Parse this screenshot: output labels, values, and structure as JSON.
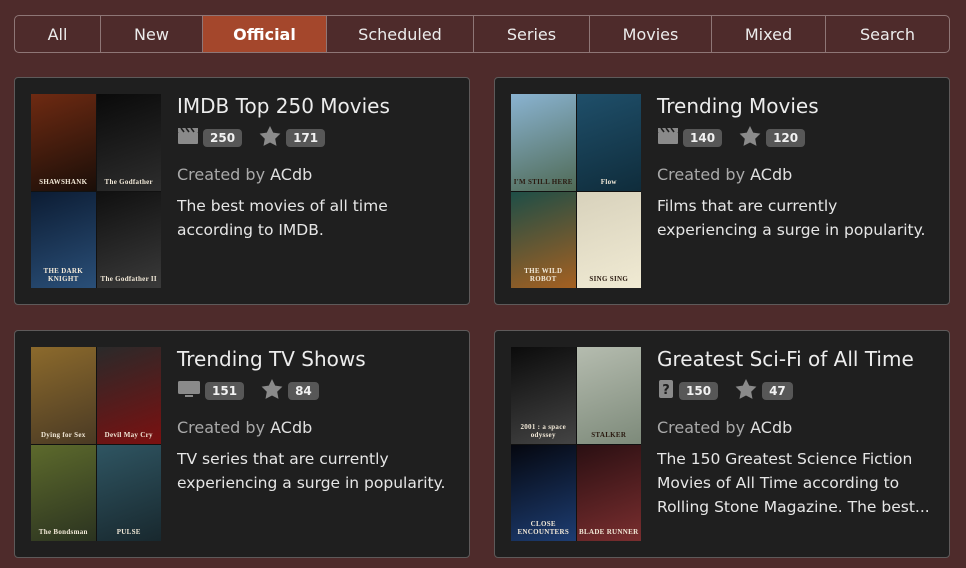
{
  "tabs": [
    {
      "label": "All",
      "active": false
    },
    {
      "label": "New",
      "active": false
    },
    {
      "label": "Official",
      "active": true
    },
    {
      "label": "Scheduled",
      "active": false
    },
    {
      "label": "Series",
      "active": false
    },
    {
      "label": "Movies",
      "active": false
    },
    {
      "label": "Mixed",
      "active": false
    },
    {
      "label": "Search",
      "active": false
    }
  ],
  "lists": [
    {
      "title": "IMDB Top 250 Movies",
      "type_icon": "clapperboard-icon",
      "item_count": "250",
      "rating_count": "171",
      "created_by_label": "Created by",
      "creator": "ACdb",
      "description": "The best movies of all time according to IMDB.",
      "posters": [
        {
          "name": "poster-shawshank",
          "caption": "SHAWSHANK",
          "colors": [
            "#6e2a12",
            "#1a0e08"
          ]
        },
        {
          "name": "poster-godfather",
          "caption": "The Godfather",
          "colors": [
            "#0a0a0a",
            "#2d2d2d"
          ]
        },
        {
          "name": "poster-dark-knight",
          "caption": "THE DARK KNIGHT",
          "colors": [
            "#0c1c33",
            "#2a4f78"
          ]
        },
        {
          "name": "poster-godfather-2",
          "caption": "The Godfather II",
          "colors": [
            "#101010",
            "#3a3a3a"
          ]
        }
      ]
    },
    {
      "title": "Trending Movies",
      "type_icon": "clapperboard-icon",
      "item_count": "140",
      "rating_count": "120",
      "created_by_label": "Created by",
      "creator": "ACdb",
      "description": "Films that are currently experiencing a surge in popularity.",
      "posters": [
        {
          "name": "poster-im-still-here",
          "caption": "I'M STILL HERE",
          "colors": [
            "#8ab3d1",
            "#4f6a55"
          ]
        },
        {
          "name": "poster-flow",
          "caption": "Flow",
          "colors": [
            "#1f4f6a",
            "#0f2c3b"
          ]
        },
        {
          "name": "poster-wild-robot",
          "caption": "THE WILD ROBOT",
          "colors": [
            "#1e4e47",
            "#a56021"
          ]
        },
        {
          "name": "poster-sing-sing",
          "caption": "SING SING",
          "colors": [
            "#d8d2bc",
            "#f0ead3"
          ]
        }
      ]
    },
    {
      "title": "Trending TV Shows",
      "type_icon": "monitor-icon",
      "item_count": "151",
      "rating_count": "84",
      "created_by_label": "Created by",
      "creator": "ACdb",
      "description": "TV series that are currently experiencing a surge in popularity.",
      "posters": [
        {
          "name": "poster-dying-for-sex",
          "caption": "Dying for Sex",
          "colors": [
            "#8c6a2c",
            "#4a3a24"
          ]
        },
        {
          "name": "poster-devil-may-cry",
          "caption": "Devil May Cry",
          "colors": [
            "#2a2a2a",
            "#7b1010"
          ]
        },
        {
          "name": "poster-bondsman",
          "caption": "The Bondsman",
          "colors": [
            "#5d6a2c",
            "#2b3320"
          ]
        },
        {
          "name": "poster-pulse",
          "caption": "PULSE",
          "colors": [
            "#2f5562",
            "#18282e"
          ]
        }
      ]
    },
    {
      "title": "Greatest Sci-Fi of All Time",
      "type_icon": "question-icon",
      "item_count": "150",
      "rating_count": "47",
      "created_by_label": "Created by",
      "creator": "ACdb",
      "description": "The 150 Greatest Science Fiction Movies of All Time according to Rolling Stone Magazine. The best...",
      "posters": [
        {
          "name": "poster-2001",
          "caption": "2001 : a space odyssey",
          "colors": [
            "#0b0b0b",
            "#444"
          ]
        },
        {
          "name": "poster-stalker",
          "caption": "STALKER",
          "colors": [
            "#b5bcaf",
            "#7d8a7a"
          ]
        },
        {
          "name": "poster-close-encounters",
          "caption": "CLOSE ENCOUNTERS",
          "colors": [
            "#05070f",
            "#1d3d72"
          ]
        },
        {
          "name": "poster-blade-runner",
          "caption": "BLADE RUNNER",
          "colors": [
            "#2a0f12",
            "#7a2e2f"
          ]
        }
      ]
    }
  ]
}
